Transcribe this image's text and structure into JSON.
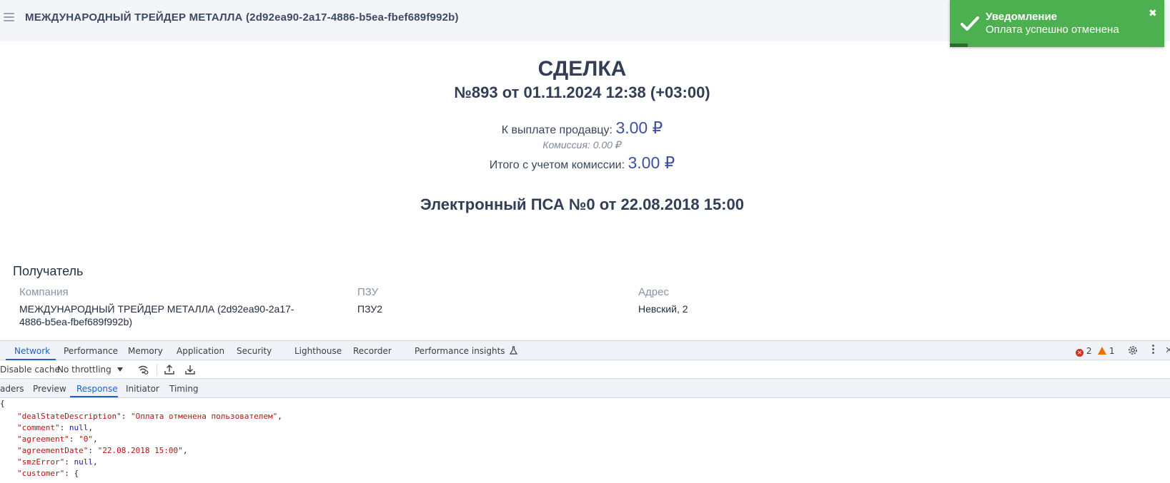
{
  "header": {
    "title": "МЕЖДУНАРОДНЫЙ ТРЕЙДЕР МЕТАЛЛА (2d92ea90-2a17-4886-b5ea-fbef689f992b)"
  },
  "toast": {
    "title": "Уведомление",
    "message": "Оплата успешно отменена",
    "close_symbol": "✖",
    "color": "#4caf50"
  },
  "deal": {
    "title": "СДЕЛКА",
    "number_line": "№893 от 01.11.2024 12:38 (+03:00)",
    "seller_label": "К выплате продавцу:",
    "seller_amount": "3.00 ₽",
    "commission_line": "Комиссия: 0.00 ₽",
    "total_label": "Итого с учетом комиссии:",
    "total_amount": "3.00 ₽",
    "psa_line": "Электронный ПСА №0 от 22.08.2018 15:00"
  },
  "recipient": {
    "section_title": "Получатель",
    "company_label": "Компания",
    "company_value_line1": "МЕЖДУНАРОДНЫЙ ТРЕЙДЕР МЕТАЛЛА (2d92ea90-2a17-",
    "company_value_line2": "4886-b5ea-fbef689f992b)",
    "pzu_label": "ПЗУ",
    "pzu_value": "ПЗУ2",
    "address_label": "Адрес",
    "address_value": "Невский, 2"
  },
  "devtools": {
    "tabs": [
      "Network",
      "Performance",
      "Memory",
      "Application",
      "Security",
      "Lighthouse",
      "Recorder",
      "Performance insights"
    ],
    "active_tab": "Network",
    "error_count": "2",
    "warning_count": "1",
    "toolbar": {
      "disable_cache": "Disable cache",
      "throttling": "No throttling"
    },
    "subtabs": [
      "aders",
      "Preview",
      "Response",
      "Initiator",
      "Timing"
    ],
    "active_subtab": "Response",
    "json": {
      "open_brace": "{",
      "lines": [
        {
          "key": "\"dealStateDescription\"",
          "value": "\"Оплата отменена пользователем\"",
          "type": "str",
          "tail": ","
        },
        {
          "key": "\"comment\"",
          "value": "null",
          "type": "null",
          "tail": ","
        },
        {
          "key": "\"agreement\"",
          "value": "\"0\"",
          "type": "str",
          "tail": ","
        },
        {
          "key": "\"agreementDate\"",
          "value": "\"22.08.2018 15:00\"",
          "type": "str",
          "tail": ","
        },
        {
          "key": "\"smzError\"",
          "value": "null",
          "type": "null",
          "tail": ","
        },
        {
          "key": "\"customer\"",
          "value": "{",
          "type": "punct",
          "tail": ""
        }
      ]
    }
  }
}
